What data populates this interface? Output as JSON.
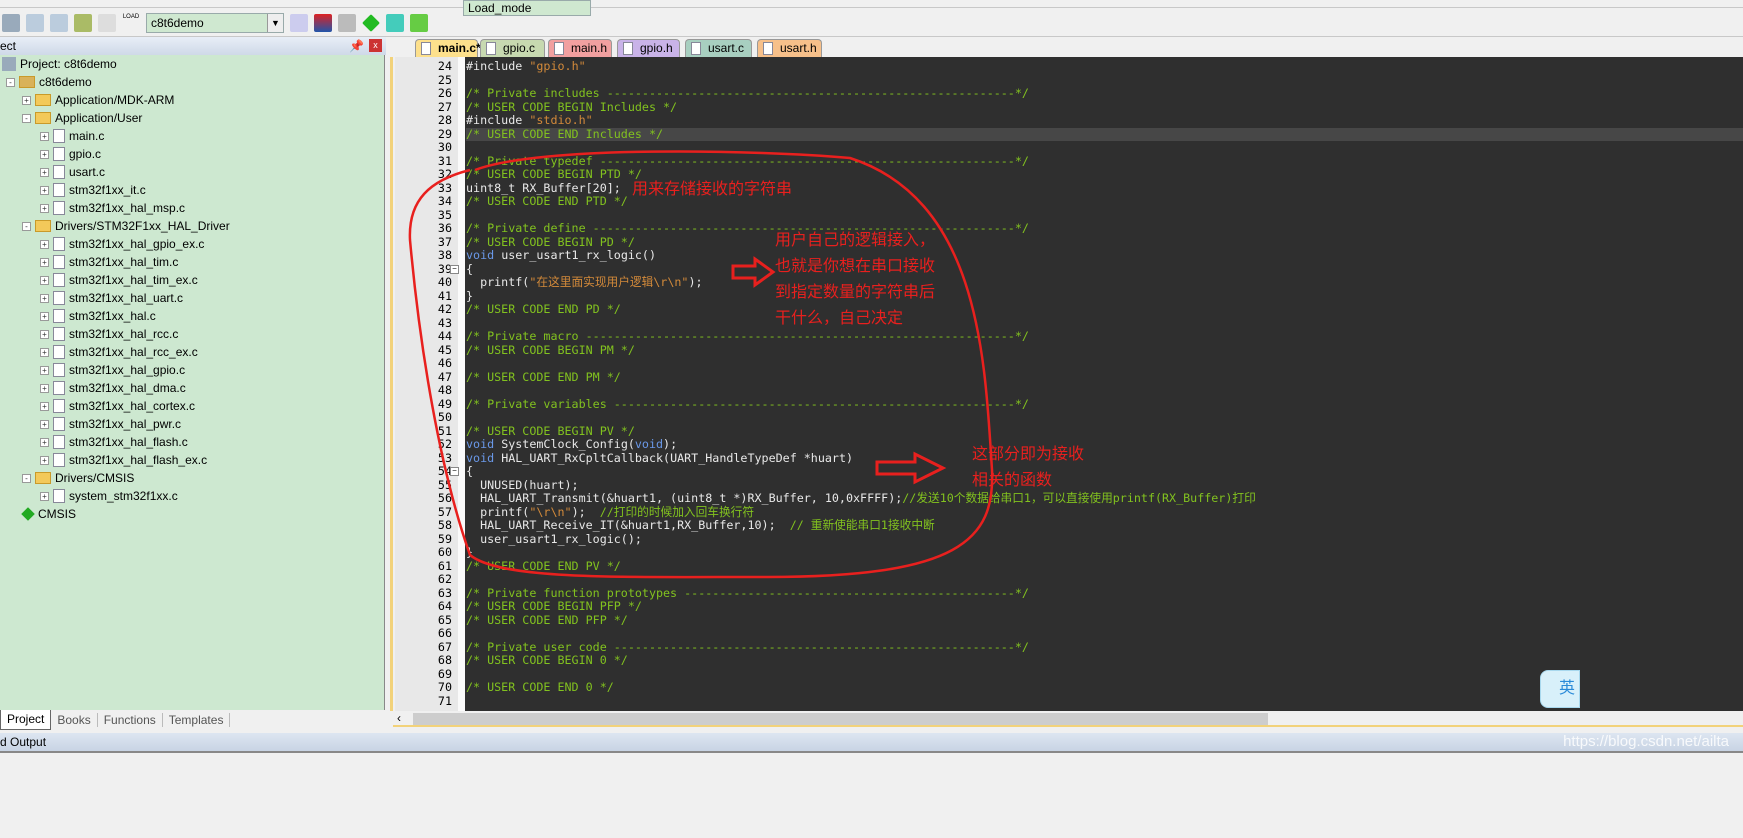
{
  "toolbar": {
    "mode_select": "Load_mode",
    "target_select": "c8t6demo",
    "load_label": "LOAD"
  },
  "sidebar": {
    "title": "ect",
    "items": [
      {
        "label": "Project: c8t6demo",
        "level": 0,
        "type": "root"
      },
      {
        "label": "c8t6demo",
        "level": 1,
        "type": "target",
        "toggle": "-"
      },
      {
        "label": "Application/MDK-ARM",
        "level": 2,
        "type": "folder",
        "toggle": "+"
      },
      {
        "label": "Application/User",
        "level": 2,
        "type": "folder",
        "toggle": "-"
      },
      {
        "label": "main.c",
        "level": 3,
        "type": "file",
        "toggle": "+"
      },
      {
        "label": "gpio.c",
        "level": 3,
        "type": "file",
        "toggle": "+"
      },
      {
        "label": "usart.c",
        "level": 3,
        "type": "file",
        "toggle": "+"
      },
      {
        "label": "stm32f1xx_it.c",
        "level": 3,
        "type": "file",
        "toggle": "+"
      },
      {
        "label": "stm32f1xx_hal_msp.c",
        "level": 3,
        "type": "file",
        "toggle": "+"
      },
      {
        "label": "Drivers/STM32F1xx_HAL_Driver",
        "level": 2,
        "type": "folder",
        "toggle": "-"
      },
      {
        "label": "stm32f1xx_hal_gpio_ex.c",
        "level": 3,
        "type": "file",
        "toggle": "+"
      },
      {
        "label": "stm32f1xx_hal_tim.c",
        "level": 3,
        "type": "file",
        "toggle": "+"
      },
      {
        "label": "stm32f1xx_hal_tim_ex.c",
        "level": 3,
        "type": "file",
        "toggle": "+"
      },
      {
        "label": "stm32f1xx_hal_uart.c",
        "level": 3,
        "type": "file",
        "toggle": "+"
      },
      {
        "label": "stm32f1xx_hal.c",
        "level": 3,
        "type": "file",
        "toggle": "+"
      },
      {
        "label": "stm32f1xx_hal_rcc.c",
        "level": 3,
        "type": "file",
        "toggle": "+"
      },
      {
        "label": "stm32f1xx_hal_rcc_ex.c",
        "level": 3,
        "type": "file",
        "toggle": "+"
      },
      {
        "label": "stm32f1xx_hal_gpio.c",
        "level": 3,
        "type": "file",
        "toggle": "+"
      },
      {
        "label": "stm32f1xx_hal_dma.c",
        "level": 3,
        "type": "file",
        "toggle": "+"
      },
      {
        "label": "stm32f1xx_hal_cortex.c",
        "level": 3,
        "type": "file",
        "toggle": "+"
      },
      {
        "label": "stm32f1xx_hal_pwr.c",
        "level": 3,
        "type": "file",
        "toggle": "+"
      },
      {
        "label": "stm32f1xx_hal_flash.c",
        "level": 3,
        "type": "file",
        "toggle": "+"
      },
      {
        "label": "stm32f1xx_hal_flash_ex.c",
        "level": 3,
        "type": "file",
        "toggle": "+"
      },
      {
        "label": "Drivers/CMSIS",
        "level": 2,
        "type": "folder",
        "toggle": "-"
      },
      {
        "label": "system_stm32f1xx.c",
        "level": 3,
        "type": "file",
        "toggle": "+"
      },
      {
        "label": "CMSIS",
        "level": 2,
        "type": "cmsis",
        "toggle": ""
      }
    ],
    "tabs": [
      "Project",
      "Books",
      "Functions",
      "Templates"
    ]
  },
  "editor_tabs": [
    {
      "label": "main.c*",
      "color": "#fde08c",
      "active": true
    },
    {
      "label": "gpio.c",
      "color": "#c7d9b0"
    },
    {
      "label": "main.h",
      "color": "#f2a0a0"
    },
    {
      "label": "gpio.h",
      "color": "#c9b3e8"
    },
    {
      "label": "usart.c",
      "color": "#a8cfc0"
    },
    {
      "label": "usart.h",
      "color": "#f7c08a"
    }
  ],
  "code": {
    "first_line": 24,
    "highlight_line": 29,
    "lines": [
      [
        [
          "p",
          "#include "
        ],
        [
          "s",
          "\"gpio.h\""
        ]
      ],
      [],
      [
        [
          "c",
          "/* Private includes ----------------------------------------------------------*/"
        ]
      ],
      [
        [
          "c",
          "/* USER CODE BEGIN Includes */"
        ]
      ],
      [
        [
          "p",
          "#include "
        ],
        [
          "s",
          "\"stdio.h\""
        ]
      ],
      [
        [
          "c",
          "/* USER CODE END Includes */"
        ]
      ],
      [],
      [
        [
          "c",
          "/* Private typedef -----------------------------------------------------------*/"
        ]
      ],
      [
        [
          "c",
          "/* USER CODE BEGIN PTD */"
        ]
      ],
      [
        [
          "p",
          "uint8_t RX_Buffer[20];"
        ]
      ],
      [
        [
          "c",
          "/* USER CODE END PTD */"
        ]
      ],
      [],
      [
        [
          "c",
          "/* Private define ------------------------------------------------------------*/"
        ]
      ],
      [
        [
          "c",
          "/* USER CODE BEGIN PD */"
        ]
      ],
      [
        [
          "k",
          "void"
        ],
        [
          "p",
          " user_usart1_rx_logic()"
        ]
      ],
      [
        [
          "p",
          "{"
        ]
      ],
      [
        [
          "p",
          "  printf("
        ],
        [
          "s",
          "\"在这里面实现用户逻辑\\r\\n\""
        ],
        [
          "p",
          ");"
        ]
      ],
      [
        [
          "p",
          "}"
        ]
      ],
      [
        [
          "c",
          "/* USER CODE END PD */"
        ]
      ],
      [],
      [
        [
          "c",
          "/* Private macro -------------------------------------------------------------*/"
        ]
      ],
      [
        [
          "c",
          "/* USER CODE BEGIN PM */"
        ]
      ],
      [],
      [
        [
          "c",
          "/* USER CODE END PM */"
        ]
      ],
      [],
      [
        [
          "c",
          "/* Private variables ---------------------------------------------------------*/"
        ]
      ],
      [],
      [
        [
          "c",
          "/* USER CODE BEGIN PV */"
        ]
      ],
      [
        [
          "k",
          "void"
        ],
        [
          "p",
          " SystemClock_Config("
        ],
        [
          "k",
          "void"
        ],
        [
          "p",
          ");"
        ]
      ],
      [
        [
          "k",
          "void"
        ],
        [
          "p",
          " HAL_UART_RxCpltCallback(UART_HandleTypeDef *huart)"
        ]
      ],
      [
        [
          "p",
          "{"
        ]
      ],
      [
        [
          "p",
          "  UNUSED(huart);"
        ]
      ],
      [
        [
          "p",
          "  HAL_UART_Transmit(&huart1, (uint8_t *)RX_Buffer, 10,0xFFFF);"
        ],
        [
          "c",
          "//发送10个数据给串口1，可以直接使用printf(RX_Buffer)打印"
        ]
      ],
      [
        [
          "p",
          "  printf("
        ],
        [
          "s",
          "\"\\r\\n\""
        ],
        [
          "p",
          ");  "
        ],
        [
          "c",
          "//打印的时候加入回车换行符"
        ]
      ],
      [
        [
          "p",
          "  HAL_UART_Receive_IT(&huart1,RX_Buffer,10);  "
        ],
        [
          "c",
          "// 重新使能串口1接收中断"
        ]
      ],
      [
        [
          "p",
          "  user_usart1_rx_logic();"
        ]
      ],
      [
        [
          "p",
          "}"
        ]
      ],
      [
        [
          "c",
          "/* USER CODE END PV */"
        ]
      ],
      [],
      [
        [
          "c",
          "/* Private function prototypes -----------------------------------------------*/"
        ]
      ],
      [
        [
          "c",
          "/* USER CODE BEGIN PFP */"
        ]
      ],
      [
        [
          "c",
          "/* USER CODE END PFP */"
        ]
      ],
      [],
      [
        [
          "c",
          "/* Private user code ---------------------------------------------------------*/"
        ]
      ],
      [
        [
          "c",
          "/* USER CODE BEGIN 0 */"
        ]
      ],
      [],
      [
        [
          "c",
          "/* USER CODE END 0 */"
        ]
      ],
      []
    ]
  },
  "annotations": {
    "buffer_note": "用来存储接收的字符串",
    "logic_note": [
      "用户自己的逻辑接入，",
      "也就是你想在串口接收",
      "到指定数量的字符串后",
      "干什么，自己决定"
    ],
    "callback_note": [
      "这部分即为接收",
      "相关的函数"
    ],
    "color": "#e8201e"
  },
  "output_panel": {
    "title": "d Output",
    "watermark": "https://blog.csdn.net/ailta"
  },
  "ime": {
    "label": "英"
  }
}
